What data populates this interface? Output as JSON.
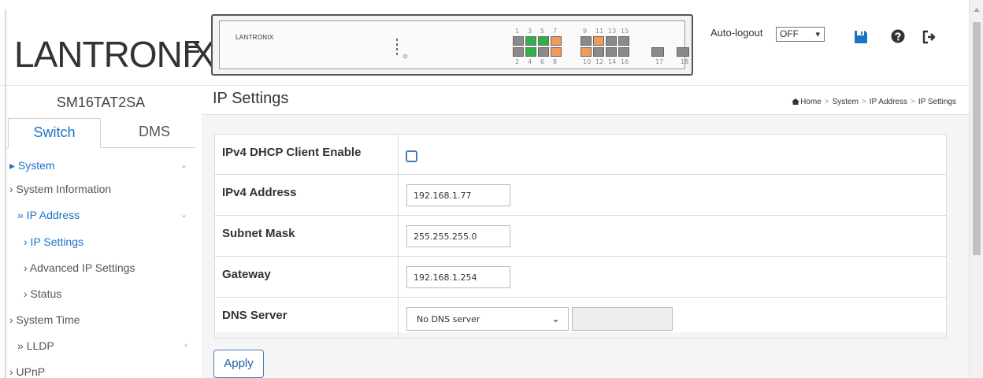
{
  "header": {
    "brand": "LANTRONIX",
    "brand_mark": "®",
    "device_brand": "LANTRONIX",
    "ports": {
      "top_labels": [
        "1",
        "3",
        "5",
        "7",
        "9",
        "11",
        "13",
        "15"
      ],
      "bottom_labels": [
        "2",
        "4",
        "6",
        "8",
        "10",
        "12",
        "14",
        "16",
        "17",
        "18"
      ],
      "top_states": [
        "gray",
        "green",
        "green",
        "orange",
        "gray",
        "orange",
        "gray",
        "gray"
      ],
      "bottom_states": [
        "gray",
        "green",
        "gray",
        "orange",
        "orange",
        "gray",
        "gray",
        "gray"
      ]
    },
    "autologout_label": "Auto-logout",
    "autologout_value": "OFF",
    "icons": [
      "menu-icon",
      "save-icon",
      "help-icon",
      "logout-icon"
    ]
  },
  "sidebar": {
    "device_name": "SM16TAT2SA",
    "tabs": [
      {
        "label": "Switch",
        "active": true
      },
      {
        "label": "DMS",
        "active": false
      }
    ],
    "items": [
      {
        "label": "▸  System",
        "caret": "⌄",
        "color": "blue"
      },
      {
        "label": "›  System Information",
        "caret": "",
        "color": "gray"
      },
      {
        "label": "»  IP Address",
        "caret": "⌄",
        "color": "blue"
      },
      {
        "label": "›  IP Settings",
        "caret": "",
        "color": "blue"
      },
      {
        "label": "›  Advanced IP Settings",
        "caret": "",
        "color": "gray"
      },
      {
        "label": "›  Status",
        "caret": "",
        "color": "gray"
      },
      {
        "label": "›  System Time",
        "caret": "",
        "color": "gray"
      },
      {
        "label": "»  LLDP",
        "caret": "‹",
        "color": "gray"
      },
      {
        "label": "›  UPnP",
        "caret": "",
        "color": "gray"
      }
    ]
  },
  "main": {
    "title": "IP Settings",
    "breadcrumb": [
      "Home",
      "System",
      "IP Address",
      "IP Settings"
    ],
    "form": {
      "dhcp_label": "IPv4 DHCP Client Enable",
      "dhcp_checked": false,
      "address_label": "IPv4 Address",
      "address_value": "192.168.1.77",
      "mask_label": "Subnet Mask",
      "mask_value": "255.255.255.0",
      "gateway_label": "Gateway",
      "gateway_value": "192.168.1.254",
      "dns_label": "DNS Server",
      "dns_value": "No DNS server"
    },
    "apply_label": "Apply"
  },
  "colors": {
    "accent": "#1a73c7",
    "brand_x": "#e86c1b",
    "port_green": "#2fb14a",
    "port_orange": "#f29a5c",
    "port_gray": "#8a8a8a"
  }
}
